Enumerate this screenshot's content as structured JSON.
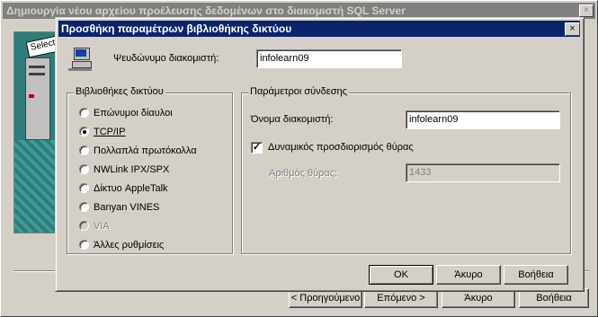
{
  "outer_dialog": {
    "title": "Δημιουργία νέου αρχείου προέλευσης δεδομένων στο διακομιστή SQL Server",
    "close": "×",
    "art_text": "Select",
    "buttons": {
      "back": "< Προηγούμενο",
      "next": "Επόμενο >",
      "cancel": "Άκυρο",
      "help": "Βοήθεια"
    }
  },
  "dialog": {
    "title": "Προσθήκη παραμέτρων βιβλιοθήκης δικτύου",
    "close": "×",
    "alias_label": "Ψευδώνυμο διακομιστή:",
    "alias_value": "infolearn09",
    "libraries": {
      "label": "Βιβλιοθήκες δικτύου",
      "options": [
        {
          "label": "Επώνυμοι δίαυλοι",
          "selected": false,
          "enabled": true
        },
        {
          "label": "TCP/IP",
          "selected": true,
          "enabled": true
        },
        {
          "label": "Πολλαπλά πρωτόκολλα",
          "selected": false,
          "enabled": true
        },
        {
          "label": "NWLink IPX/SPX",
          "selected": false,
          "enabled": true
        },
        {
          "label": "Δίκτυο AppleTalk",
          "selected": false,
          "enabled": true
        },
        {
          "label": "Banyan VINES",
          "selected": false,
          "enabled": true
        },
        {
          "label": "VIA",
          "selected": false,
          "enabled": false
        },
        {
          "label": "Άλλες ρυθμίσεις",
          "selected": false,
          "enabled": true
        }
      ]
    },
    "connection": {
      "label": "Παράμετροι σύνδεσης",
      "server_name_label": "Όνομα διακομιστή:",
      "server_name_value": "infolearn09",
      "dynamic_port_label": "Δυναμικός προσδιορισμός θύρας",
      "dynamic_port_checked": true,
      "port_label": "Αριθμός θύρας:",
      "port_value": "1433"
    },
    "buttons": {
      "ok": "OK",
      "cancel": "Άκυρο",
      "help": "Βοήθεια"
    }
  }
}
